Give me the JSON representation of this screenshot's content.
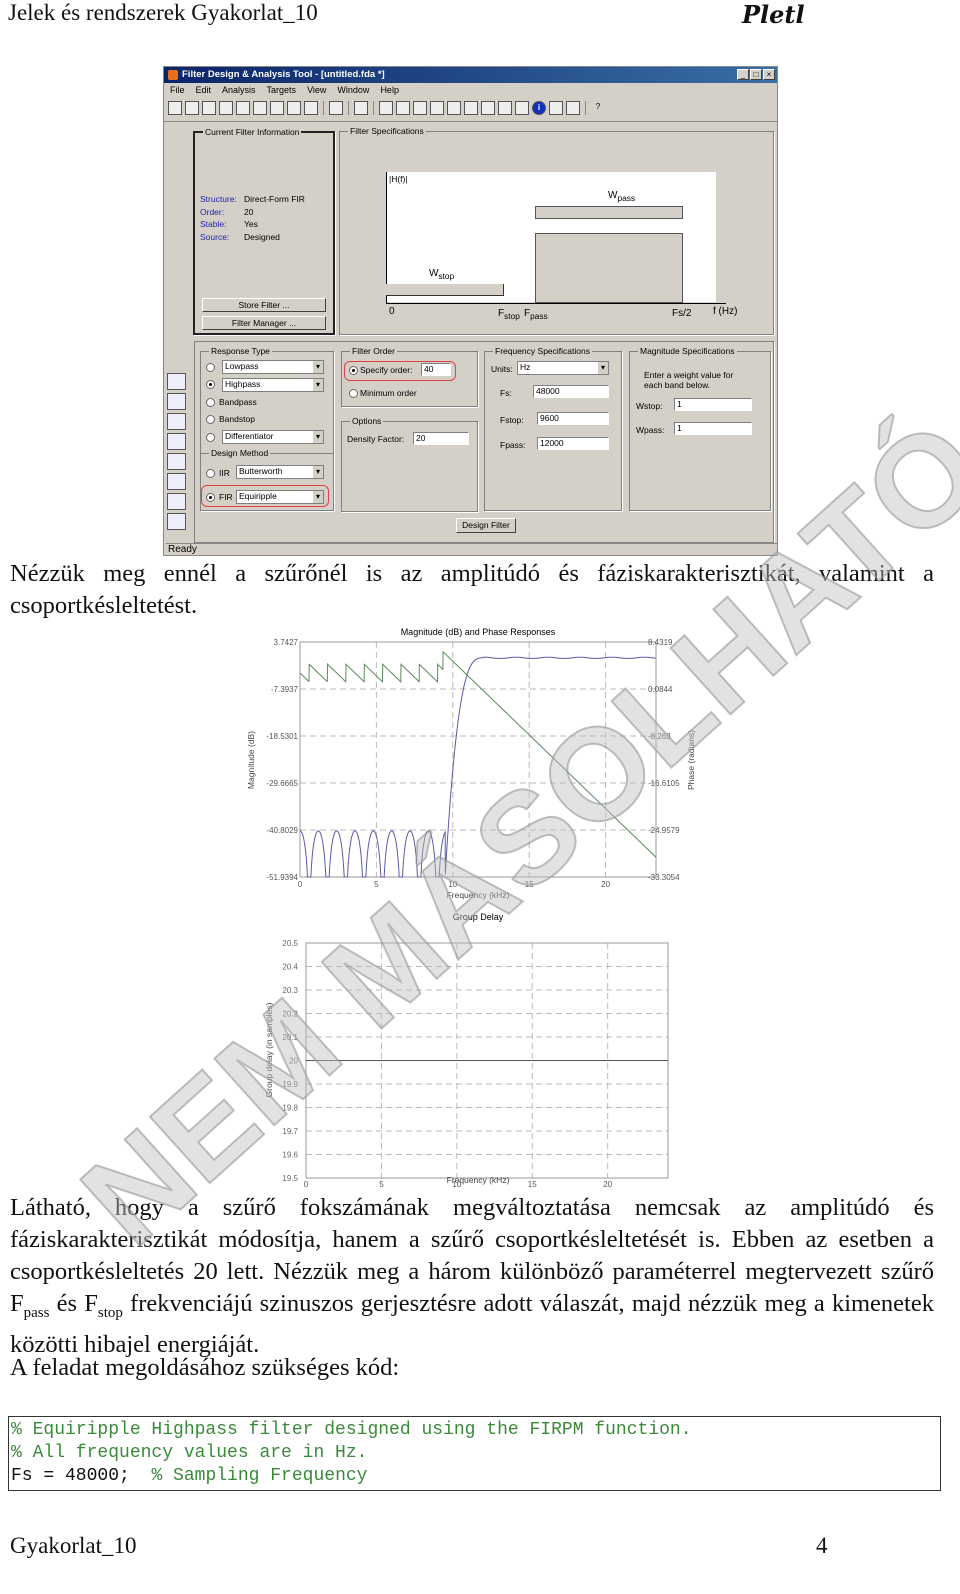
{
  "header": {
    "title": "Jelek és rendszerek Gyakorlat_10",
    "logo": "Pletl"
  },
  "watermark": "NEM MÁSOLHATÓ",
  "fdatool": {
    "title": "Filter Design & Analysis Tool - [untitled.fda *]",
    "menu": [
      "File",
      "Edit",
      "Analysis",
      "Targets",
      "View",
      "Window",
      "Help"
    ],
    "toolbar_icons": [
      "new-icon",
      "open-icon",
      "save-icon",
      "print-icon",
      "print-preview-icon",
      "zoom-in-icon",
      "zoom-out-icon",
      "zoom-x-icon",
      "full-view-icon",
      "sep",
      "new-window-icon",
      "sep",
      "filter-spec-icon",
      "sep",
      "magnitude-icon",
      "phase-icon",
      "mag-phase-icon",
      "group-delay-icon",
      "phase-delay-icon",
      "impulse-icon",
      "step-icon",
      "pole-zero-icon",
      "coefficients-icon",
      "info-icon",
      "magnitude-estimate-icon",
      "noise-icon",
      "sep",
      "whats-this-icon"
    ],
    "current_info": {
      "label": "Current Filter Information",
      "rows": [
        {
          "k": "Structure:",
          "v": "Direct-Form FIR"
        },
        {
          "k": "Order:",
          "v": "20"
        },
        {
          "k": "Stable:",
          "v": "Yes"
        },
        {
          "k": "Source:",
          "v": "Designed"
        }
      ],
      "store": "Store Filter ...",
      "manager": "Filter Manager ..."
    },
    "spec": {
      "label": "Filter Specifications",
      "h": "|H(f)|",
      "wpass": "W",
      "wpass_sub": "pass",
      "wstop": "W",
      "wstop_sub": "stop",
      "zero": "0",
      "fstop": "F",
      "fstop_sub": "stop",
      "fpass": "F",
      "fpass_sub": "pass",
      "fs2": "Fs/2",
      "fhz": "f (Hz)"
    },
    "response": {
      "label": "Response Type",
      "lowpass": "Lowpass",
      "highpass": "Highpass",
      "bandpass": "Bandpass",
      "bandstop": "Bandstop",
      "diff": "Differentiator",
      "selected": "Highpass"
    },
    "method": {
      "label": "Design Method",
      "iir": "IIR",
      "iir_value": "Butterworth",
      "fir": "FIR",
      "fir_value": "Equiripple",
      "selected": "FIR"
    },
    "order": {
      "label": "Filter Order",
      "specify": "Specify order:",
      "value": "40",
      "minimum": "Minimum order",
      "selected": "Specify order"
    },
    "options": {
      "label": "Options",
      "density_label": "Density Factor:",
      "density": "20"
    },
    "freq": {
      "label": "Frequency Specifications",
      "units_label": "Units:",
      "units": "Hz",
      "fs_label": "Fs:",
      "fs": "48000",
      "fstop_label": "Fstop:",
      "fstop": "9600",
      "fpass_label": "Fpass:",
      "fpass": "12000"
    },
    "mag": {
      "label": "Magnitude Specifications",
      "note1": "Enter a weight value for",
      "note2": "each band below.",
      "wstop_label": "Wstop:",
      "wstop": "1",
      "wpass_label": "Wpass:",
      "wpass": "1"
    },
    "design_button": "Design Filter",
    "status": "Ready"
  },
  "para1": "Nézzük meg ennél a szűrőnél is az amplitúdó és fáziskarakterisztikát, valamint a csoportkésleltetést.",
  "chart_data": [
    {
      "type": "line",
      "title": "Magnitude (dB) and Phase Responses",
      "xlabel": "Frequency (kHz)",
      "ylabel": "Magnitude (dB)",
      "ylabel_right": "Phase (radians)",
      "xlim": [
        0,
        23.3
      ],
      "ylim": [
        -51.9394,
        3.7427
      ],
      "ylim_right": [
        -33.3054,
        8.4319
      ],
      "xticks": [
        "0",
        "5",
        "10",
        "15",
        "20"
      ],
      "yticks": [
        "3.7427",
        "-7.3937",
        "-18.5301",
        "-29.6665",
        "-40.8029",
        "-51.9394"
      ],
      "yticks_right": [
        "8.4319",
        "0.0844",
        "-8.263",
        "-16.6105",
        "-24.9579",
        "-33.3054"
      ],
      "grid": true,
      "series": [
        {
          "color": "#5a5aa8",
          "stopband_peak_db": -41,
          "fstop_khz": 9.6,
          "fpass_khz": 12,
          "passband_db": 0
        },
        {
          "color": "#5a8a5a",
          "phase_at_0": 2.93,
          "slope_rad_per_khz": -2.618,
          "end_value": -30.5
        }
      ]
    },
    {
      "type": "line",
      "title": "Group Delay",
      "xlabel": "Frequency (kHz)",
      "ylabel": "Group delay (in samples)",
      "xlim": [
        0,
        24
      ],
      "ylim": [
        19.5,
        20.5
      ],
      "xticks": [
        "0",
        "5",
        "10",
        "15",
        "20"
      ],
      "yticks": [
        "20.5",
        "20.4",
        "20.3",
        "20.2",
        "20.1",
        "20",
        "19.9",
        "19.8",
        "19.7",
        "19.6",
        "19.5"
      ],
      "grid": true,
      "series": [
        {
          "color": "#555555",
          "x": [
            0,
            24
          ],
          "y": [
            20,
            20
          ]
        }
      ]
    }
  ],
  "para2": {
    "l1": "Látható, hogy a szűrő fokszámának megváltoztatása nemcsak az amplitúdó és fáziskarakterisztikát módosítja, hanem a szűrő csoportkésleltetését is. Ebben az esetben a csoportkésleltetés 20 lett. Nézzük meg a három különböző paraméterrel megtervezett szűrő F",
    "pass": "pass",
    "mid": " és F",
    "stop": "stop",
    "l2": " frekvenciájú szinuszos gerjesztésre adott válaszát, majd nézzük meg a kimenetek közötti hibajel energiáját.",
    "l3": "A feladat megoldásához szükséges kód:"
  },
  "code": {
    "line1": "% Equiripple Highpass filter designed using the FIRPM function.",
    "line2": "% All frequency values are in Hz.",
    "line3a": "Fs = 48000;  ",
    "line3b": "% Sampling Frequency"
  },
  "footer": {
    "left": "Gyakorlat_10",
    "page": "4"
  }
}
